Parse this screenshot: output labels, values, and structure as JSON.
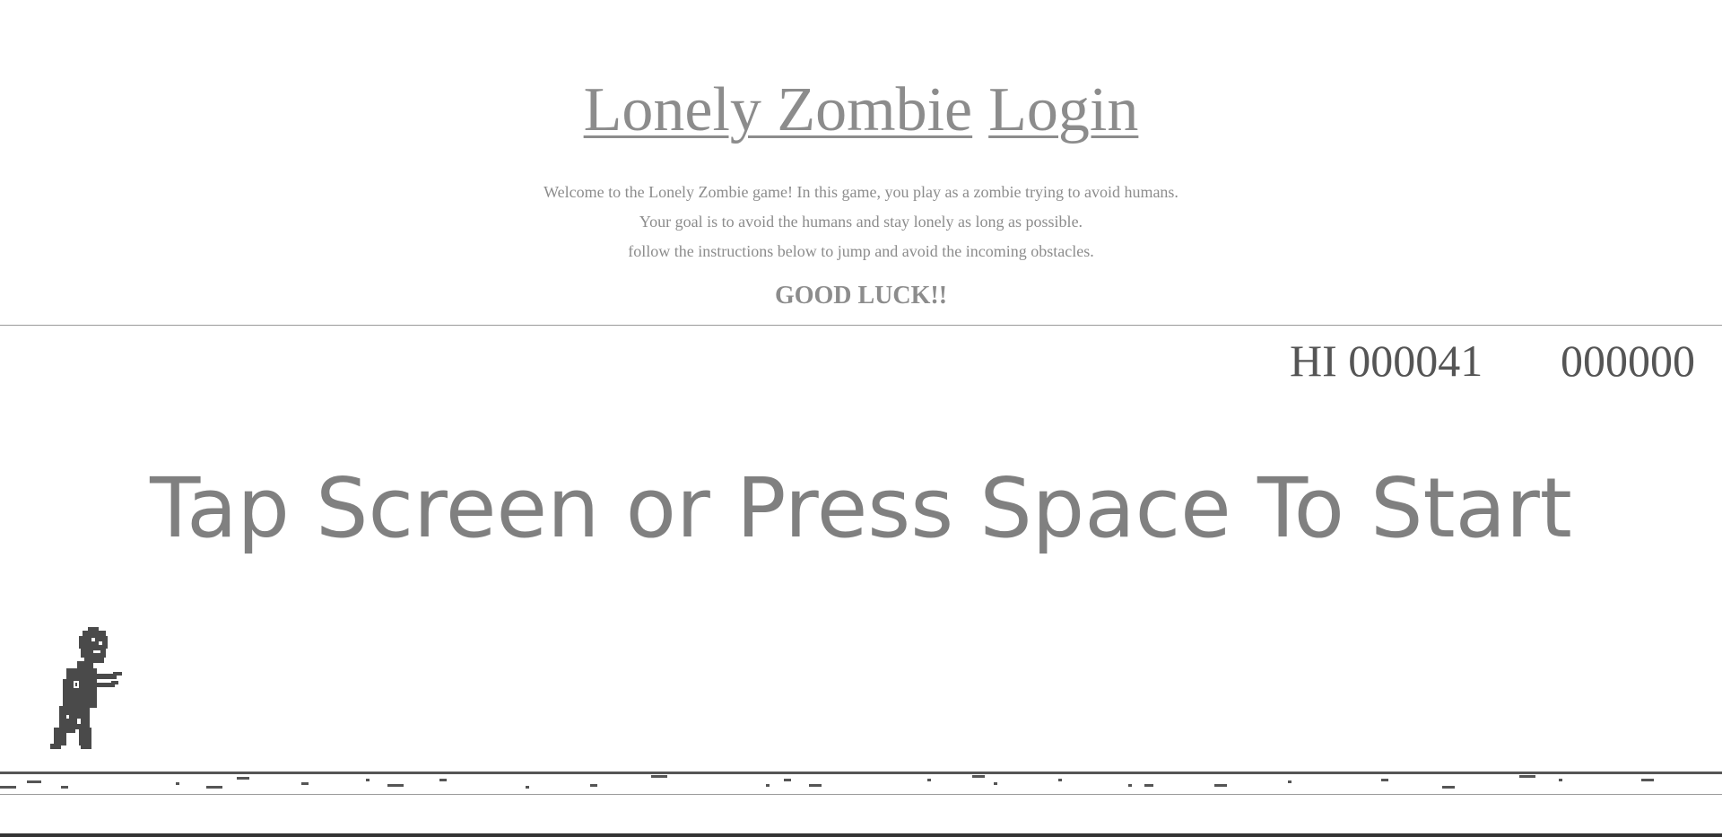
{
  "header": {
    "title_game": "Lonely Zombie",
    "title_login": "Login",
    "description": [
      "Welcome to the Lonely Zombie game! In this game, you play as a zombie trying to avoid humans.",
      "Your goal is to avoid the humans and stay lonely as long as possible.",
      "follow the instructions below to jump and avoid the incoming obstacles."
    ],
    "good_luck": "GOOD LUCK!!"
  },
  "game": {
    "high_score": "HI 000041",
    "current_score": "000000",
    "start_message": "Tap Screen or Press Space To Start",
    "colors": {
      "ground": "#555555",
      "zombie": "#4a4a4a",
      "text": "#808080"
    }
  }
}
